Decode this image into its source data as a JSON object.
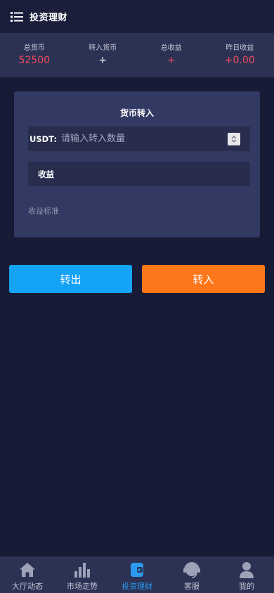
{
  "header": {
    "title": "投资理财",
    "menu_icon": "menu-list-icon"
  },
  "stats": [
    {
      "label": "总货币",
      "value": "52500",
      "color": "#f34a57"
    },
    {
      "label": "转入货币",
      "value": "+",
      "color": "#ffffff"
    },
    {
      "label": "总收益",
      "value": "+",
      "color": "#f34a57"
    },
    {
      "label": "昨日收益",
      "value": "+0.00",
      "color": "#f34a57"
    }
  ],
  "card": {
    "title": "货币转入",
    "amount_prefix": "USDT:",
    "amount_placeholder": "请输入转入数量",
    "amount_value": "",
    "earnings_label": "收益",
    "standard_label": "收益标准"
  },
  "buttons": {
    "out_label": "转出",
    "in_label": "转入",
    "out_color": "#14a3f5",
    "in_color": "#fd771a"
  },
  "nav": {
    "active": "投资理财",
    "active_color": "#2b9aee",
    "items": [
      {
        "label": "大厅动态",
        "icon": "home-icon"
      },
      {
        "label": "市场走势",
        "icon": "bar-chart-icon"
      },
      {
        "label": "投资理财",
        "icon": "wallet-icon"
      },
      {
        "label": "客服",
        "icon": "headset-icon"
      },
      {
        "label": "我的",
        "icon": "user-icon"
      }
    ]
  }
}
